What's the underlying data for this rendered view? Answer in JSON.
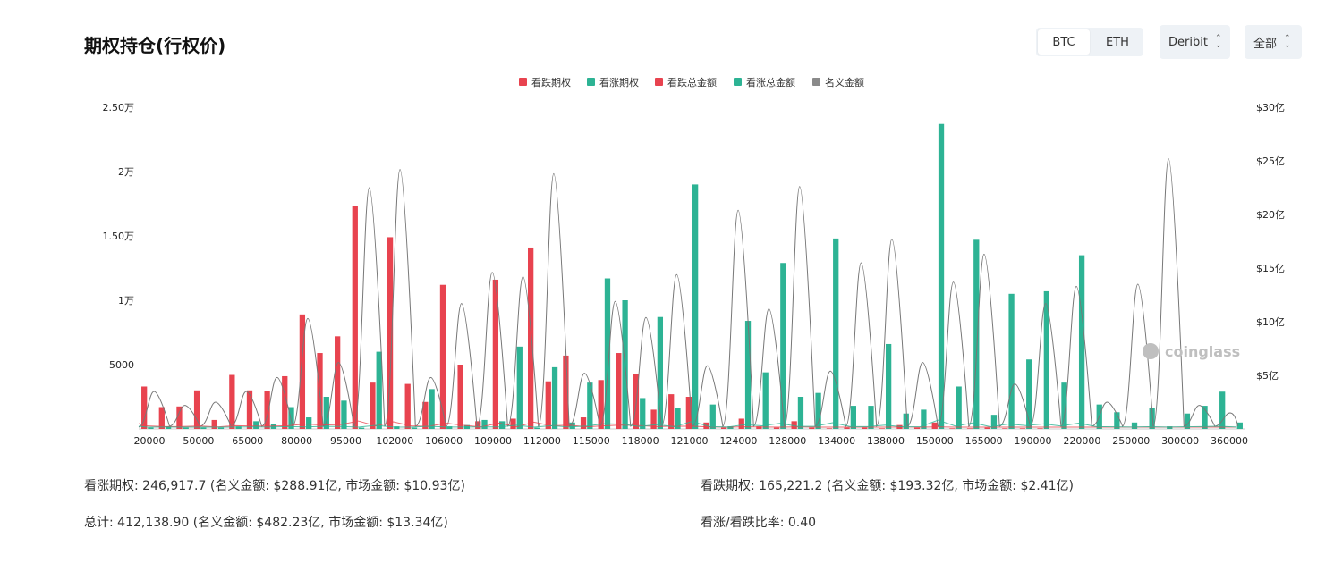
{
  "header": {
    "title": "期权持仓(行权价)",
    "coin_tabs": [
      {
        "label": "BTC",
        "active": true
      },
      {
        "label": "ETH",
        "active": false
      }
    ],
    "exchange_select": "Deribit",
    "type_select": "全部"
  },
  "watermark": "coinglass",
  "colors": {
    "put": "#e8434f",
    "call": "#2db394",
    "notional": "#8a8a8a",
    "line": "#777777"
  },
  "chart_data": {
    "type": "bar",
    "legend": [
      {
        "name": "看跌期权",
        "color": "#e8434f"
      },
      {
        "name": "看涨期权",
        "color": "#2db394"
      },
      {
        "name": "看跌总金额",
        "color": "#e8434f"
      },
      {
        "name": "看涨总金额",
        "color": "#2db394"
      },
      {
        "name": "名义金额",
        "color": "#8a8a8a"
      }
    ],
    "legend_position": "top-center",
    "y_left_ticks": [
      "2.50万",
      "2万",
      "1.50万",
      "1万",
      "5000"
    ],
    "y_left_range": [
      0,
      25000
    ],
    "y_right_ticks": [
      "$30亿",
      "$25亿",
      "$20亿",
      "$15亿",
      "$10亿",
      "$5亿"
    ],
    "y_right_range": [
      0,
      3000000000
    ],
    "x_tick_labels": [
      "20000",
      "50000",
      "65000",
      "80000",
      "95000",
      "102000",
      "106000",
      "109000",
      "112000",
      "115000",
      "118000",
      "121000",
      "124000",
      "128000",
      "134000",
      "138000",
      "150000",
      "165000",
      "190000",
      "220000",
      "250000",
      "300000",
      "360000"
    ],
    "put_values": [
      3300,
      1700,
      1750,
      3000,
      700,
      4200,
      3000,
      2950,
      4100,
      8900,
      5900,
      7200,
      17300,
      3600,
      14900,
      3500,
      2100,
      11200,
      5000,
      600,
      11600,
      800,
      14100,
      3700,
      5700,
      900,
      3800,
      5900,
      4300,
      1500,
      2700,
      2500,
      500,
      100,
      800,
      200,
      100,
      600,
      100,
      50,
      100,
      100,
      50,
      300,
      100,
      500,
      50,
      50,
      100,
      50,
      50,
      50,
      0,
      0,
      0,
      0,
      0,
      0,
      0,
      0,
      0,
      0,
      0
    ],
    "call_values": [
      100,
      200,
      100,
      100,
      100,
      200,
      600,
      400,
      1700,
      900,
      2500,
      2200,
      100,
      6000,
      200,
      100,
      3100,
      200,
      300,
      700,
      600,
      6400,
      100,
      4800,
      500,
      3600,
      11700,
      10000,
      2400,
      8700,
      1600,
      19000,
      1900,
      200,
      8400,
      4400,
      12900,
      2500,
      2800,
      14800,
      1800,
      1800,
      6600,
      1200,
      1500,
      23700,
      3300,
      14700,
      1100,
      10500,
      5400,
      10700,
      3600,
      13500,
      1900,
      1300,
      500,
      1600,
      200,
      1200,
      1800,
      2900,
      500,
      500,
      300,
      1000
    ],
    "notional_peaks_usd": [
      350000000,
      220000000,
      250000000,
      350000000,
      480000000,
      1030000000,
      620000000,
      2250000000,
      2420000000,
      480000000,
      1170000000,
      1460000000,
      1420000000,
      2380000000,
      520000000,
      1190000000,
      1040000000,
      1440000000,
      590000000,
      2040000000,
      1120000000,
      2260000000,
      540000000,
      1550000000,
      1770000000,
      620000000,
      1370000000,
      1630000000,
      420000000,
      1170000000,
      1330000000,
      250000000,
      1350000000,
      2520000000,
      220000000,
      150000000
    ]
  },
  "summary": {
    "call": "看涨期权: 246,917.7 (名义金额: $288.91亿, 市场金额: $10.93亿)",
    "put": "看跌期权: 165,221.2 (名义金额: $193.32亿, 市场金额: $2.41亿)",
    "total": "总计: 412,138.90 (名义金额: $482.23亿, 市场金额: $13.34亿)",
    "ratio": "看涨/看跌比率: 0.40"
  }
}
